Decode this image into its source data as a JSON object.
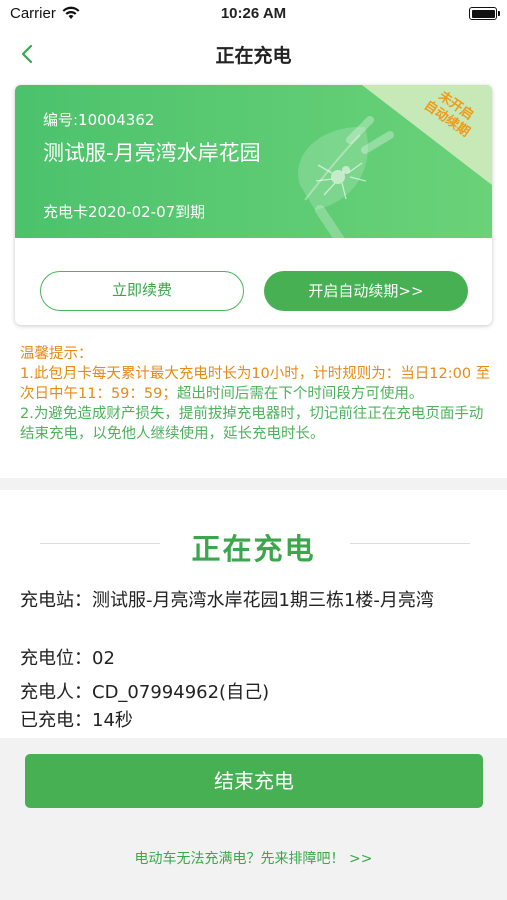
{
  "status_bar": {
    "carrier": "Carrier",
    "time": "10:26 AM"
  },
  "nav": {
    "title": "正在充电"
  },
  "card": {
    "number": "编号:10004362",
    "station": "测试服-月亮湾水岸花园",
    "expire": "充电卡2020-02-07到期",
    "corner_line1": "未开启",
    "corner_line2": "自动续期",
    "renew_button": "立即续费",
    "auto_renew_button": "开启自动续期>>"
  },
  "tips": {
    "title": "温馨提示：",
    "line1_orange": "1.此包月卡每天累计最大充电时长为10小时，计时规则为：当日12:00 至 次日中午11：59：59；",
    "line1_green": "超出时间后需在下个时间段方可使用。",
    "line2": "2.为避免造成财产损失，提前拔掉充电器时，切记前往正在充电页面手动结束充电，以免他人继续使用，延长充电时长。"
  },
  "status": {
    "heading": "正在充电",
    "station_label": "充电站：",
    "station_value": "测试服-月亮湾水岸花园1期三栋1楼-月亮湾",
    "slot_label": "充电位：",
    "slot_value": "02",
    "user_label": "充电人：",
    "user_value": "CD_07994962(自己)",
    "duration_label": "已充电：",
    "duration_value": "14秒"
  },
  "end_button": "结束充电",
  "trouble_link": "电动车无法充满电？先来排障吧！ >>",
  "colors": {
    "green": "#46b052",
    "orange": "#e88a18"
  },
  "icons": {
    "back": "chevron-left-icon",
    "wifi": "wifi-icon",
    "battery": "battery-icon",
    "plug": "plug-leaf-icon"
  }
}
